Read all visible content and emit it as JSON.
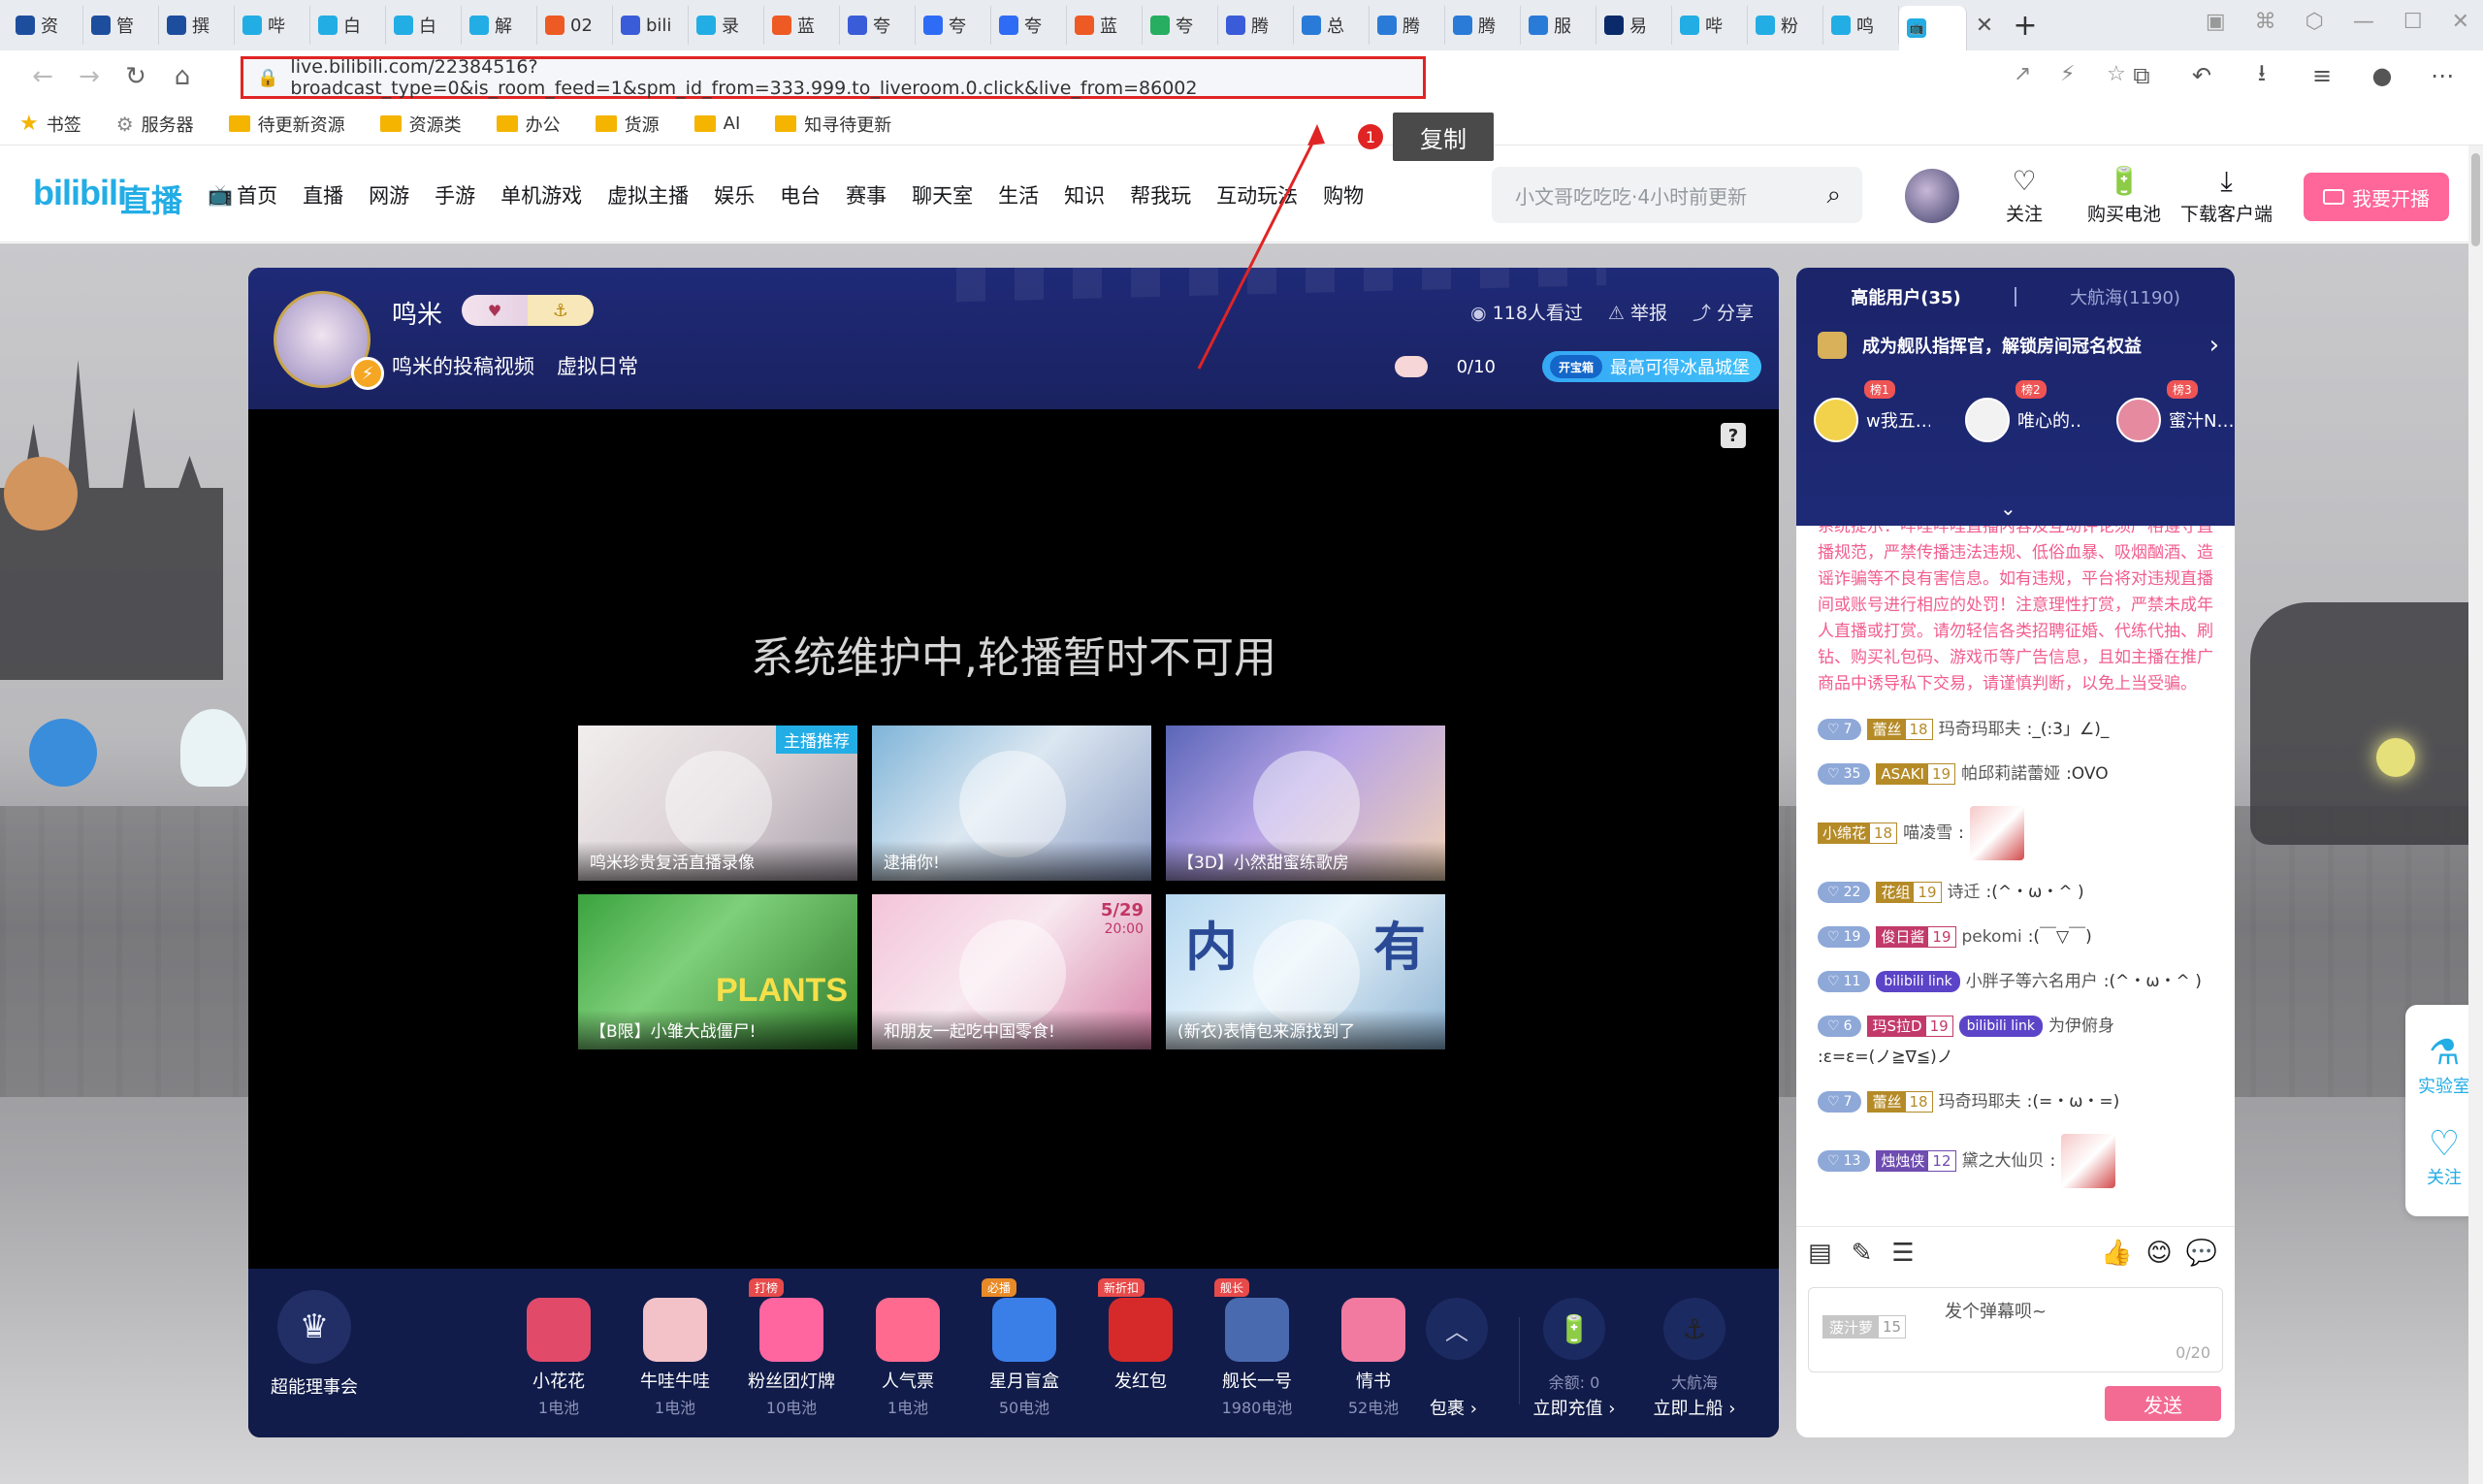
{
  "browser": {
    "tabs": [
      {
        "label": "资",
        "color": "#1d4e9e"
      },
      {
        "label": "管",
        "color": "#1d4e9e"
      },
      {
        "label": "撰",
        "color": "#1d4e9e"
      },
      {
        "label": "哔",
        "color": "#23ade5"
      },
      {
        "label": "白",
        "color": "#23ade5"
      },
      {
        "label": "白",
        "color": "#23ade5"
      },
      {
        "label": "解",
        "color": "#23ade5"
      },
      {
        "label": "02",
        "color": "#ee5a24"
      },
      {
        "label": "bili",
        "color": "#3b5cd9"
      },
      {
        "label": "录",
        "color": "#23ade5"
      },
      {
        "label": "蓝",
        "color": "#ee5a24"
      },
      {
        "label": "夸",
        "color": "#3b5cd9"
      },
      {
        "label": "夸",
        "color": "#2f6cf5"
      },
      {
        "label": "夸",
        "color": "#2f6cf5"
      },
      {
        "label": "蓝",
        "color": "#ee5a24"
      },
      {
        "label": "夸",
        "color": "#27ae60"
      },
      {
        "label": "腾",
        "color": "#3b5cd9"
      },
      {
        "label": "总",
        "color": "#2a7bd8"
      },
      {
        "label": "腾",
        "color": "#2a7bd8"
      },
      {
        "label": "腾",
        "color": "#2a7bd8"
      },
      {
        "label": "服",
        "color": "#2a7bd8"
      },
      {
        "label": "易",
        "color": "#0a2a6a"
      },
      {
        "label": "哔",
        "color": "#23ade5"
      },
      {
        "label": "粉",
        "color": "#23ade5"
      },
      {
        "label": "鸣",
        "color": "#23ade5"
      }
    ],
    "active_tab_icon": "bilibili-tv-icon",
    "url": "live.bilibili.com/22384516?broadcast_type=0&is_room_feed=1&spm_id_from=333.999.to_liveroom.0.click&live_from=86002",
    "bookmarks": [
      "书签",
      "服务器",
      "待更新资源",
      "资源类",
      "办公",
      "货源",
      "AI",
      "知寻待更新"
    ]
  },
  "annotation": {
    "step": "1",
    "tooltip": "复制",
    "color": "#e02424"
  },
  "site_header": {
    "logo": "bilibili",
    "logo_suffix": "直播",
    "nav": [
      "首页",
      "直播",
      "网游",
      "手游",
      "单机游戏",
      "虚拟主播",
      "娱乐",
      "电台",
      "赛事",
      "聊天室",
      "生活",
      "知识",
      "帮我玩",
      "互动玩法",
      "购物"
    ],
    "search_placeholder": "小文哥吃吃吃·4小时前更新",
    "actions": [
      {
        "label": "关注",
        "icon": "heart-icon"
      },
      {
        "label": "购买电池",
        "icon": "battery-icon"
      },
      {
        "label": "下载客户端",
        "icon": "download-icon"
      }
    ],
    "start_live": "我要开播",
    "accent": "#ff6699",
    "brand": "#23ade5"
  },
  "room": {
    "streamer": "鸣米",
    "title": "鸣米的投稿视频",
    "area": "虚拟日常",
    "viewers": "118人看过",
    "report": "举报",
    "share": "分享",
    "lottery_count": "0/10",
    "promo": "最高可得冰晶城堡",
    "promo_mark": "开宝箱",
    "maintenance": "系统维护中,轮播暂时不可用",
    "thumbs": [
      {
        "caption": "鸣米珍贵复活直播录像",
        "tag": "主播推荐"
      },
      {
        "caption": "逮捕你!",
        "tag": ""
      },
      {
        "caption": "【3D】小然甜蜜练歌房",
        "tag": ""
      },
      {
        "caption": "【B限】小雏大战僵尸!",
        "tag": "",
        "big": "PLANTS"
      },
      {
        "caption": "和朋友一起吃中国零食!",
        "tag": "",
        "date": "5/29",
        "time": "20:00"
      },
      {
        "caption": "(新衣)表情包来源找到了",
        "tag": "",
        "big1": "内",
        "big2": "有"
      }
    ]
  },
  "giftbar": {
    "vip": "超能理事会",
    "gifts": [
      {
        "name": "小花花",
        "price": "1电池",
        "badge": "",
        "color": "#e24a6a"
      },
      {
        "name": "牛哇牛哇",
        "price": "1电池",
        "badge": "",
        "color": "#f2c2c8"
      },
      {
        "name": "粉丝团灯牌",
        "price": "10电池",
        "badge": "打榜",
        "color": "#ff66a0"
      },
      {
        "name": "人气票",
        "price": "1电池",
        "badge": "",
        "color": "#ff6a8e"
      },
      {
        "name": "星月盲盒",
        "price": "50电池",
        "badge": "必播",
        "color": "#3a7ee8"
      },
      {
        "name": "发红包",
        "price": "",
        "badge": "新折扣",
        "color": "#d62a2a"
      },
      {
        "name": "舰长一号",
        "price": "1980电池",
        "badge": "舰长",
        "color": "#4a6ab0"
      },
      {
        "name": "情书",
        "price": "52电池",
        "badge": "",
        "color": "#f27aa0"
      }
    ],
    "more": "包裹",
    "balance_label": "余额: 0",
    "recharge": "立即充值",
    "captain_label": "大航海",
    "board": "立即上船"
  },
  "side": {
    "tab_high": "高能用户(35)",
    "tab_guard": "大航海(1190)",
    "guard_promo": "成为舰队指挥官，解锁房间冠名权益",
    "top3": [
      {
        "name": "w我五…",
        "rank": "榜1",
        "color": "#f2d24a"
      },
      {
        "name": "唯心的…",
        "rank": "榜2",
        "color": "#f2f2f2"
      },
      {
        "name": "蜜汁N…",
        "rank": "榜3",
        "color": "#e68aa0"
      }
    ],
    "system": "系统提示：哔哩哔哩直播内容及互动评论须严格遵守直播规范，严禁传播违法违规、低俗血暴、吸烟酗酒、造谣诈骗等不良有害信息。如有违规，平台将对违规直播间或账号进行相应的处罚！注意理性打赏，严禁未成年人直播或打赏。请勿轻信各类招聘征婚、代练代抽、刷钻、购买礼包码、游戏币等广告信息，且如主播在推广商品中诱导私下交易，请谨慎判断，以免上当受骗。",
    "messages": [
      {
        "lv": "7",
        "medal": "蕾丝",
        "mlv": "18",
        "style": "g",
        "user": "玛奇玛耶夫",
        "text": ":_(:3」∠)_",
        "emote": false,
        "link": ""
      },
      {
        "lv": "35",
        "medal": "ASAKI",
        "mlv": "19",
        "style": "g",
        "user": "帕邱莉諾蕾娅",
        "text": ":OVO",
        "emote": false,
        "link": ""
      },
      {
        "lv": "",
        "medal": "小绵花",
        "mlv": "18",
        "style": "g",
        "user": "喵凌雪",
        "text": ":",
        "emote": true,
        "link": ""
      },
      {
        "lv": "22",
        "medal": "花组",
        "mlv": "19",
        "style": "g",
        "user": "诗迁",
        "text": ":(^・ω・^ )",
        "emote": false,
        "link": ""
      },
      {
        "lv": "19",
        "medal": "俊日酱",
        "mlv": "19",
        "style": "p",
        "user": "pekomi",
        "text": ":(￣▽￣)",
        "emote": false,
        "link": ""
      },
      {
        "lv": "11",
        "medal": "",
        "mlv": "",
        "style": "g",
        "user": "小胖子等六名用户",
        "text": ":(^・ω・^ )",
        "emote": false,
        "link": "bilibili link"
      },
      {
        "lv": "6",
        "medal": "玛S拉D",
        "mlv": "19",
        "style": "p",
        "user": "为伊俯身",
        "text": ":ε=ε=(ノ≧∇≦)ノ",
        "emote": false,
        "link": "bilibili link"
      },
      {
        "lv": "7",
        "medal": "蕾丝",
        "mlv": "18",
        "style": "g",
        "user": "玛奇玛耶夫",
        "text": ":(=・ω・=)",
        "emote": false,
        "link": ""
      },
      {
        "lv": "13",
        "medal": "烛烛侠",
        "mlv": "12",
        "style": "pu",
        "user": "黛之大仙贝",
        "text": ":",
        "emote": true,
        "link": ""
      }
    ],
    "composer_medal": "菠汁萝",
    "composer_medal_lv": "15",
    "composer_placeholder": "发个弹幕呗~",
    "composer_count": "0/20",
    "send": "发送"
  },
  "floating": {
    "lab": "实验室",
    "follow": "关注"
  }
}
